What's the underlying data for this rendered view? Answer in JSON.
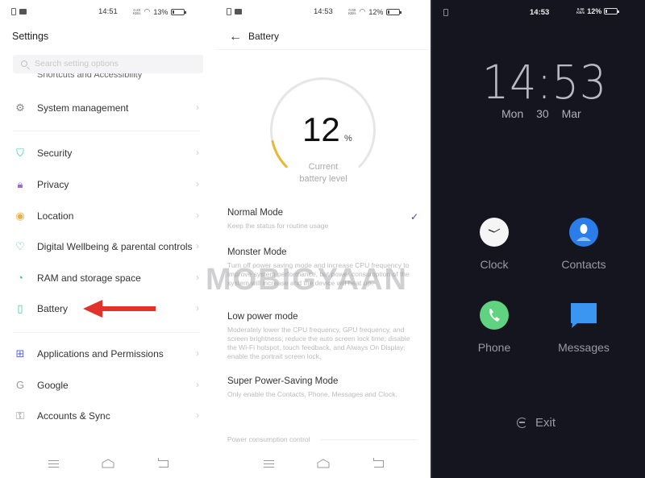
{
  "settings": {
    "status": {
      "time": "14:51",
      "speed_top": "0.20",
      "speed_bottom": "KB/s",
      "battery": "13%",
      "battery_fraction": 0.13
    },
    "title": "Settings",
    "search_placeholder": "Search setting options",
    "partial_item": "Shortcuts and Accessibility",
    "items": [
      {
        "label": "System management",
        "icon": "gear-icon",
        "color": "#888888"
      },
      {
        "label": "Security",
        "icon": "shield-icon",
        "color": "#3cc6b0"
      },
      {
        "label": "Privacy",
        "icon": "lock-icon",
        "color": "#a06ad6"
      },
      {
        "label": "Location",
        "icon": "location-pin-icon",
        "color": "#e8b24a"
      },
      {
        "label": "Digital Wellbeing & parental controls",
        "icon": "wellbeing-icon",
        "color": "#3cc6b0"
      },
      {
        "label": "RAM and storage space",
        "icon": "pie-chart-icon",
        "color": "#3cc6b0"
      },
      {
        "label": "Battery",
        "icon": "battery-icon",
        "color": "#3cc6b0"
      },
      {
        "label": "Applications and Permissions",
        "icon": "apps-grid-icon",
        "color": "#5b6ad6"
      },
      {
        "label": "Google",
        "icon": "google-icon",
        "color": "#999999"
      },
      {
        "label": "Accounts & Sync",
        "icon": "key-icon",
        "color": "#888888"
      }
    ],
    "chevron": "›"
  },
  "battery": {
    "status": {
      "time": "14:53",
      "speed_top": "0.00",
      "speed_bottom": "KB/s",
      "battery": "12%",
      "battery_fraction": 0.12
    },
    "title": "Battery",
    "level_number": "12",
    "level_unit": "%",
    "level_fraction": 0.12,
    "level_caption_1": "Current",
    "level_caption_2": "battery  level",
    "accent": "#e8b830",
    "modes": [
      {
        "name": "Normal Mode",
        "desc": "Keep the status for routine usage",
        "selected": true
      },
      {
        "name": "Monster Mode",
        "desc": "Turn off power saving mode and increase CPU frequency to improve system performance, but power consumption of the system will increase and the device will heat up.",
        "selected": false
      },
      {
        "name": "Low power mode",
        "desc": "Moderately lower the CPU frequency, GPU frequency, and screen brightness; reduce the auto screen lock time; disable the Wi-Fi hotspot, touch feedback, and Always On Display; enable the portrait screen lock.",
        "selected": false
      },
      {
        "name": "Super Power-Saving Mode",
        "desc": "Only enable the Contacts, Phone, Messages and Clock.",
        "selected": false
      }
    ],
    "check": "✓",
    "section_label": "Power consumption control"
  },
  "lock": {
    "status": {
      "time": "14:53",
      "speed_top": "0.00",
      "speed_bottom": "KB/s",
      "battery": "12%",
      "battery_fraction": 0.12
    },
    "clock": "14:53",
    "date": "Mon  30 Mar",
    "apps": [
      {
        "label": "Clock",
        "color": "#f5f5f5"
      },
      {
        "label": "Contacts",
        "color": "#2b7de9"
      },
      {
        "label": "Phone",
        "color": "#5fd37f"
      },
      {
        "label": "Messages",
        "color": "#3a96f0"
      }
    ],
    "exit_label": "Exit"
  },
  "watermark": "MOBIGYAAN"
}
